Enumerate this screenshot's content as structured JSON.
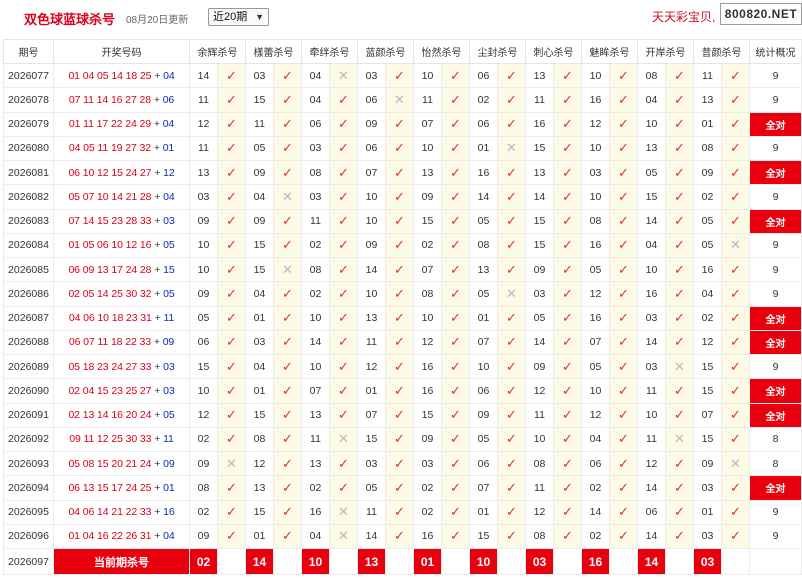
{
  "header": {
    "title": "双色球蓝球杀号",
    "date": "08月20日更新",
    "period_select": "近20期",
    "brand": "天天彩宝贝,",
    "site": "800820.NET"
  },
  "columns": [
    "期号",
    "开奖号码",
    "余辉杀号",
    "樣蕾杀号",
    "牵绊杀号",
    "蓝颜杀号",
    "怡然杀号",
    "尘封杀号",
    "刺心杀号",
    "魅眸杀号",
    "开岸杀号",
    "昔颜杀号",
    "统计概况"
  ],
  "rows": [
    {
      "period": "2026077",
      "reds": "01 04 05 14 18 25",
      "blue": "04",
      "kills": [
        [
          "14",
          "ok"
        ],
        [
          "03",
          "ok"
        ],
        [
          "04",
          "bad"
        ],
        [
          "03",
          "ok"
        ],
        [
          "10",
          "ok"
        ],
        [
          "06",
          "ok"
        ],
        [
          "13",
          "ok"
        ],
        [
          "10",
          "ok"
        ],
        [
          "08",
          "ok"
        ],
        [
          "11",
          "ok"
        ]
      ],
      "count": "9"
    },
    {
      "period": "2026078",
      "reds": "07 11 14 16 27 28",
      "blue": "06",
      "kills": [
        [
          "11",
          "ok"
        ],
        [
          "15",
          "ok"
        ],
        [
          "04",
          "ok"
        ],
        [
          "06",
          "bad"
        ],
        [
          "11",
          "ok"
        ],
        [
          "02",
          "ok"
        ],
        [
          "11",
          "ok"
        ],
        [
          "16",
          "ok"
        ],
        [
          "04",
          "ok"
        ],
        [
          "13",
          "ok"
        ]
      ],
      "count": "9"
    },
    {
      "period": "2026079",
      "reds": "01 11 17 22 24 29",
      "blue": "04",
      "kills": [
        [
          "12",
          "ok"
        ],
        [
          "11",
          "ok"
        ],
        [
          "06",
          "ok"
        ],
        [
          "09",
          "ok"
        ],
        [
          "07",
          "ok"
        ],
        [
          "06",
          "ok"
        ],
        [
          "16",
          "ok"
        ],
        [
          "12",
          "ok"
        ],
        [
          "10",
          "ok"
        ],
        [
          "01",
          "ok"
        ]
      ],
      "count": "全对"
    },
    {
      "period": "2026080",
      "reds": "04 05 11 19 27 32",
      "blue": "01",
      "kills": [
        [
          "11",
          "ok"
        ],
        [
          "05",
          "ok"
        ],
        [
          "03",
          "ok"
        ],
        [
          "06",
          "ok"
        ],
        [
          "10",
          "ok"
        ],
        [
          "01",
          "bad"
        ],
        [
          "15",
          "ok"
        ],
        [
          "10",
          "ok"
        ],
        [
          "13",
          "ok"
        ],
        [
          "08",
          "ok"
        ]
      ],
      "count": "9"
    },
    {
      "period": "2026081",
      "reds": "06 10 12 15 24 27",
      "blue": "12",
      "kills": [
        [
          "13",
          "ok"
        ],
        [
          "09",
          "ok"
        ],
        [
          "08",
          "ok"
        ],
        [
          "07",
          "ok"
        ],
        [
          "13",
          "ok"
        ],
        [
          "16",
          "ok"
        ],
        [
          "13",
          "ok"
        ],
        [
          "03",
          "ok"
        ],
        [
          "05",
          "ok"
        ],
        [
          "09",
          "ok"
        ]
      ],
      "count": "全对"
    },
    {
      "period": "2026082",
      "reds": "05 07 10 14 21 28",
      "blue": "04",
      "kills": [
        [
          "03",
          "ok"
        ],
        [
          "04",
          "bad"
        ],
        [
          "03",
          "ok"
        ],
        [
          "10",
          "ok"
        ],
        [
          "09",
          "ok"
        ],
        [
          "14",
          "ok"
        ],
        [
          "14",
          "ok"
        ],
        [
          "10",
          "ok"
        ],
        [
          "15",
          "ok"
        ],
        [
          "02",
          "ok"
        ]
      ],
      "count": "9"
    },
    {
      "period": "2026083",
      "reds": "07 14 15 23 28 33",
      "blue": "03",
      "kills": [
        [
          "09",
          "ok"
        ],
        [
          "09",
          "ok"
        ],
        [
          "11",
          "ok"
        ],
        [
          "10",
          "ok"
        ],
        [
          "15",
          "ok"
        ],
        [
          "05",
          "ok"
        ],
        [
          "15",
          "ok"
        ],
        [
          "08",
          "ok"
        ],
        [
          "14",
          "ok"
        ],
        [
          "05",
          "ok"
        ]
      ],
      "count": "全对"
    },
    {
      "period": "2026084",
      "reds": "01 05 06 10 12 16",
      "blue": "05",
      "kills": [
        [
          "10",
          "ok"
        ],
        [
          "15",
          "ok"
        ],
        [
          "02",
          "ok"
        ],
        [
          "09",
          "ok"
        ],
        [
          "02",
          "ok"
        ],
        [
          "08",
          "ok"
        ],
        [
          "15",
          "ok"
        ],
        [
          "16",
          "ok"
        ],
        [
          "04",
          "ok"
        ],
        [
          "05",
          "bad"
        ]
      ],
      "count": "9"
    },
    {
      "period": "2026085",
      "reds": "06 09 13 17 24 28",
      "blue": "15",
      "kills": [
        [
          "10",
          "ok"
        ],
        [
          "15",
          "bad"
        ],
        [
          "08",
          "ok"
        ],
        [
          "14",
          "ok"
        ],
        [
          "07",
          "ok"
        ],
        [
          "13",
          "ok"
        ],
        [
          "09",
          "ok"
        ],
        [
          "05",
          "ok"
        ],
        [
          "10",
          "ok"
        ],
        [
          "16",
          "ok"
        ]
      ],
      "count": "9"
    },
    {
      "period": "2026086",
      "reds": "02 05 14 25 30 32",
      "blue": "05",
      "kills": [
        [
          "09",
          "ok"
        ],
        [
          "04",
          "ok"
        ],
        [
          "02",
          "ok"
        ],
        [
          "10",
          "ok"
        ],
        [
          "08",
          "ok"
        ],
        [
          "05",
          "bad"
        ],
        [
          "03",
          "ok"
        ],
        [
          "12",
          "ok"
        ],
        [
          "16",
          "ok"
        ],
        [
          "04",
          "ok"
        ]
      ],
      "count": "9"
    },
    {
      "period": "2026087",
      "reds": "04 06 10 18 23 31",
      "blue": "11",
      "kills": [
        [
          "05",
          "ok"
        ],
        [
          "01",
          "ok"
        ],
        [
          "10",
          "ok"
        ],
        [
          "13",
          "ok"
        ],
        [
          "10",
          "ok"
        ],
        [
          "01",
          "ok"
        ],
        [
          "05",
          "ok"
        ],
        [
          "16",
          "ok"
        ],
        [
          "03",
          "ok"
        ],
        [
          "02",
          "ok"
        ]
      ],
      "count": "全对"
    },
    {
      "period": "2026088",
      "reds": "06 07 11 18 22 33",
      "blue": "09",
      "kills": [
        [
          "06",
          "ok"
        ],
        [
          "03",
          "ok"
        ],
        [
          "14",
          "ok"
        ],
        [
          "11",
          "ok"
        ],
        [
          "12",
          "ok"
        ],
        [
          "07",
          "ok"
        ],
        [
          "14",
          "ok"
        ],
        [
          "07",
          "ok"
        ],
        [
          "14",
          "ok"
        ],
        [
          "12",
          "ok"
        ]
      ],
      "count": "全对"
    },
    {
      "period": "2026089",
      "reds": "05 18 23 24 27 33",
      "blue": "03",
      "kills": [
        [
          "15",
          "ok"
        ],
        [
          "04",
          "ok"
        ],
        [
          "10",
          "ok"
        ],
        [
          "12",
          "ok"
        ],
        [
          "16",
          "ok"
        ],
        [
          "10",
          "ok"
        ],
        [
          "09",
          "ok"
        ],
        [
          "05",
          "ok"
        ],
        [
          "03",
          "bad"
        ],
        [
          "15",
          "ok"
        ]
      ],
      "count": "9"
    },
    {
      "period": "2026090",
      "reds": "02 04 15 23 25 27",
      "blue": "03",
      "kills": [
        [
          "10",
          "ok"
        ],
        [
          "01",
          "ok"
        ],
        [
          "07",
          "ok"
        ],
        [
          "01",
          "ok"
        ],
        [
          "16",
          "ok"
        ],
        [
          "06",
          "ok"
        ],
        [
          "12",
          "ok"
        ],
        [
          "10",
          "ok"
        ],
        [
          "11",
          "ok"
        ],
        [
          "15",
          "ok"
        ]
      ],
      "count": "全对"
    },
    {
      "period": "2026091",
      "reds": "02 13 14 16 20 24",
      "blue": "05",
      "kills": [
        [
          "12",
          "ok"
        ],
        [
          "15",
          "ok"
        ],
        [
          "13",
          "ok"
        ],
        [
          "07",
          "ok"
        ],
        [
          "15",
          "ok"
        ],
        [
          "09",
          "ok"
        ],
        [
          "11",
          "ok"
        ],
        [
          "12",
          "ok"
        ],
        [
          "10",
          "ok"
        ],
        [
          "07",
          "ok"
        ]
      ],
      "count": "全对"
    },
    {
      "period": "2026092",
      "reds": "09 11 12 25 30 33",
      "blue": "11",
      "kills": [
        [
          "02",
          "ok"
        ],
        [
          "08",
          "ok"
        ],
        [
          "11",
          "bad"
        ],
        [
          "15",
          "ok"
        ],
        [
          "09",
          "ok"
        ],
        [
          "05",
          "ok"
        ],
        [
          "10",
          "ok"
        ],
        [
          "04",
          "ok"
        ],
        [
          "11",
          "bad"
        ],
        [
          "15",
          "ok"
        ]
      ],
      "count": "8"
    },
    {
      "period": "2026093",
      "reds": "05 08 15 20 21 24",
      "blue": "09",
      "kills": [
        [
          "09",
          "bad"
        ],
        [
          "12",
          "ok"
        ],
        [
          "13",
          "ok"
        ],
        [
          "03",
          "ok"
        ],
        [
          "03",
          "ok"
        ],
        [
          "06",
          "ok"
        ],
        [
          "08",
          "ok"
        ],
        [
          "06",
          "ok"
        ],
        [
          "12",
          "ok"
        ],
        [
          "09",
          "bad"
        ]
      ],
      "count": "8"
    },
    {
      "period": "2026094",
      "reds": "06 13 15 17 24 25",
      "blue": "01",
      "kills": [
        [
          "08",
          "ok"
        ],
        [
          "13",
          "ok"
        ],
        [
          "02",
          "ok"
        ],
        [
          "05",
          "ok"
        ],
        [
          "02",
          "ok"
        ],
        [
          "07",
          "ok"
        ],
        [
          "11",
          "ok"
        ],
        [
          "02",
          "ok"
        ],
        [
          "14",
          "ok"
        ],
        [
          "03",
          "ok"
        ]
      ],
      "count": "全对"
    },
    {
      "period": "2026095",
      "reds": "04 06 14 21 22 33",
      "blue": "16",
      "kills": [
        [
          "02",
          "ok"
        ],
        [
          "15",
          "ok"
        ],
        [
          "16",
          "bad"
        ],
        [
          "11",
          "ok"
        ],
        [
          "02",
          "ok"
        ],
        [
          "01",
          "ok"
        ],
        [
          "12",
          "ok"
        ],
        [
          "14",
          "ok"
        ],
        [
          "06",
          "ok"
        ],
        [
          "01",
          "ok"
        ]
      ],
      "count": "9"
    },
    {
      "period": "2026096",
      "reds": "01 04 16 22 26 31",
      "blue": "04",
      "kills": [
        [
          "09",
          "ok"
        ],
        [
          "01",
          "ok"
        ],
        [
          "04",
          "bad"
        ],
        [
          "14",
          "ok"
        ],
        [
          "16",
          "ok"
        ],
        [
          "15",
          "ok"
        ],
        [
          "08",
          "ok"
        ],
        [
          "02",
          "ok"
        ],
        [
          "14",
          "ok"
        ],
        [
          "03",
          "ok"
        ]
      ],
      "count": "9"
    }
  ],
  "current": {
    "period": "2026097",
    "label": "当前期杀号",
    "kills": [
      "02",
      "14",
      "10",
      "13",
      "01",
      "10",
      "03",
      "16",
      "14",
      "03"
    ]
  },
  "icons": {
    "ok": "✓",
    "bad": "✕"
  },
  "colors": {
    "accent": "#e8000f",
    "red_ball": "#d9001b",
    "blue_ball": "#0a2bb0",
    "mark_bg": "#fdfbe6"
  }
}
